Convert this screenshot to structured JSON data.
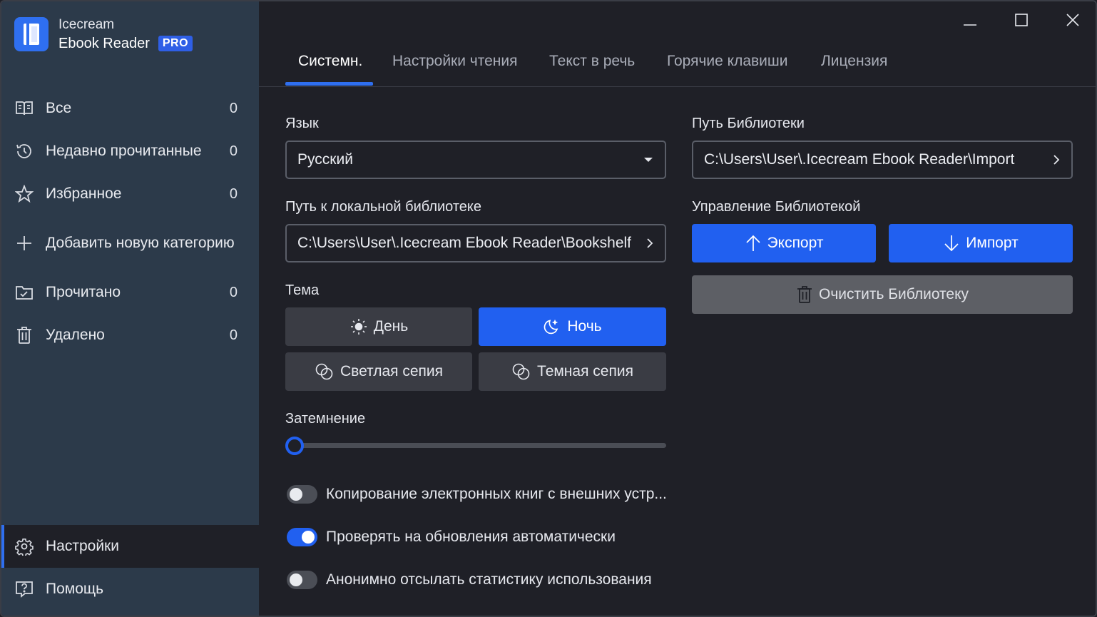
{
  "app": {
    "name_line1": "Icecream",
    "name_line2": "Ebook Reader",
    "badge": "PRO"
  },
  "sidebar": {
    "items": [
      {
        "label": "Все",
        "count": "0",
        "icon": "book-open-icon"
      },
      {
        "label": "Недавно прочитанные",
        "count": "0",
        "icon": "history-icon"
      },
      {
        "label": "Избранное",
        "count": "0",
        "icon": "star-icon"
      },
      {
        "label": "Добавить новую категорию",
        "icon": "plus-icon"
      },
      {
        "label": "Прочитано",
        "count": "0",
        "icon": "folder-check-icon"
      },
      {
        "label": "Удалено",
        "count": "0",
        "icon": "trash-icon"
      }
    ],
    "settings": {
      "label": "Настройки",
      "icon": "gear-icon"
    },
    "help": {
      "label": "Помощь",
      "icon": "help-icon"
    }
  },
  "tabs": [
    {
      "label": "Системн.",
      "active": true
    },
    {
      "label": "Настройки чтения"
    },
    {
      "label": "Текст в речь"
    },
    {
      "label": "Горячие клавиши"
    },
    {
      "label": "Лицензия"
    }
  ],
  "settings": {
    "language": {
      "label": "Язык",
      "value": "Русский"
    },
    "local_path": {
      "label": "Путь к локальной библиотеке",
      "value": "C:\\Users\\User\\.Icecream Ebook Reader\\Bookshelf"
    },
    "theme": {
      "label": "Тема",
      "options": [
        {
          "label": "День",
          "icon": "sun-icon"
        },
        {
          "label": "Ночь",
          "icon": "moon-icon",
          "selected": true
        },
        {
          "label": "Светлая сепия",
          "icon": "sepia-icon"
        },
        {
          "label": "Темная сепия",
          "icon": "sepia-icon"
        }
      ]
    },
    "dimming": {
      "label": "Затемнение",
      "value": 0
    },
    "toggles": [
      {
        "label": "Копирование электронных книг с внешних устр...",
        "on": false
      },
      {
        "label": "Проверять на обновления автоматически",
        "on": true
      },
      {
        "label": "Анонимно отсылать статистику использования",
        "on": false
      }
    ],
    "library_path": {
      "label": "Путь Библиотеки",
      "value": "C:\\Users\\User\\.Icecream Ebook Reader\\Import"
    },
    "library_management": {
      "label": "Управление Библиотекой",
      "export_label": "Экспорт",
      "import_label": "Импорт",
      "clear_label": "Очистить Библиотеку"
    }
  },
  "colors": {
    "accent": "#2160f0",
    "sidebar_bg": "#2c3a4a",
    "main_bg": "#1f2027"
  }
}
